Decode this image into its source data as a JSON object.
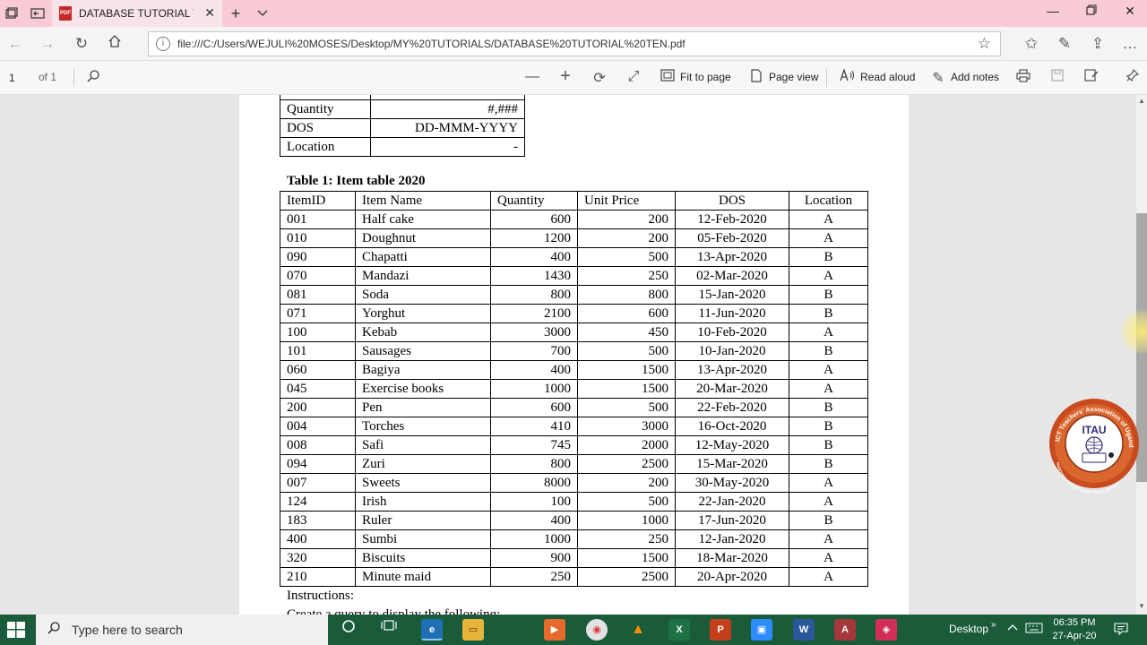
{
  "browser": {
    "tab_title": "DATABASE TUTORIAL TE",
    "pdf_badge": "PDF",
    "url": "file:///C:/Users/WEJULI%20MOSES/Desktop/MY%20TUTORIALS/DATABASE%20TUTORIAL%20TEN.pdf"
  },
  "pdf_toolbar": {
    "page_number": "1",
    "page_count": "of 1",
    "fit_to_page": "Fit to page",
    "page_view": "Page view",
    "read_aloud": "Read aloud",
    "add_notes": "Add notes"
  },
  "format_table": {
    "rows": [
      {
        "field": "Quantity",
        "format": "#,###"
      },
      {
        "field": "DOS",
        "format": "DD-MMM-YYYY"
      },
      {
        "field": "Location",
        "format": "-"
      }
    ]
  },
  "item_table": {
    "caption": "Table 1: Item table 2020",
    "headers": [
      "ItemID",
      "Item Name",
      "Quantity",
      "Unit Price",
      "DOS",
      "Location"
    ],
    "rows": [
      [
        "001",
        "Half cake",
        "600",
        "200",
        "12-Feb-2020",
        "A"
      ],
      [
        "010",
        "Doughnut",
        "1200",
        "200",
        "05-Feb-2020",
        "A"
      ],
      [
        "090",
        "Chapatti",
        "400",
        "500",
        "13-Apr-2020",
        "B"
      ],
      [
        "070",
        "Mandazi",
        "1430",
        "250",
        "02-Mar-2020",
        "A"
      ],
      [
        "081",
        "Soda",
        "800",
        "800",
        "15-Jan-2020",
        "B"
      ],
      [
        "071",
        "Yorghut",
        "2100",
        "600",
        "11-Jun-2020",
        "B"
      ],
      [
        "100",
        "Kebab",
        "3000",
        "450",
        "10-Feb-2020",
        "A"
      ],
      [
        "101",
        "Sausages",
        "700",
        "500",
        "10-Jan-2020",
        "B"
      ],
      [
        "060",
        "Bagiya",
        "400",
        "1500",
        "13-Apr-2020",
        "A"
      ],
      [
        "045",
        "Exercise books",
        "1000",
        "1500",
        "20-Mar-2020",
        "A"
      ],
      [
        "200",
        "Pen",
        "600",
        "500",
        "22-Feb-2020",
        "B"
      ],
      [
        "004",
        "Torches",
        "410",
        "3000",
        "16-Oct-2020",
        "B"
      ],
      [
        "008",
        "Safi",
        "745",
        "2000",
        "12-May-2020",
        "B"
      ],
      [
        "094",
        "Zuri",
        "800",
        "2500",
        "15-Mar-2020",
        "B"
      ],
      [
        "007",
        "Sweets",
        "8000",
        "200",
        "30-May-2020",
        "A"
      ],
      [
        "124",
        "Irish",
        "100",
        "500",
        "22-Jan-2020",
        "A"
      ],
      [
        "183",
        "Ruler",
        "400",
        "1000",
        "17-Jun-2020",
        "B"
      ],
      [
        "400",
        "Sumbi",
        "1000",
        "250",
        "12-Jan-2020",
        "A"
      ],
      [
        "320",
        "Biscuits",
        "900",
        "1500",
        "18-Mar-2020",
        "A"
      ],
      [
        "210",
        "Minute maid",
        "250",
        "2500",
        "20-Apr-2020",
        "A"
      ]
    ]
  },
  "instructions_heading": "Instructions:",
  "instructions_partial": "Create a query to display the following:",
  "logo": {
    "main": "ITAU",
    "ring_top": "ICT Teachers' Association of Uganda",
    "ring_bottom": "TOGETHER AGAINST COMPUTER ILLITERACY"
  },
  "taskbar": {
    "search_placeholder": "Type here to search",
    "desktop_label": "Desktop",
    "time": "06:35 PM",
    "date": "27-Apr-20"
  }
}
